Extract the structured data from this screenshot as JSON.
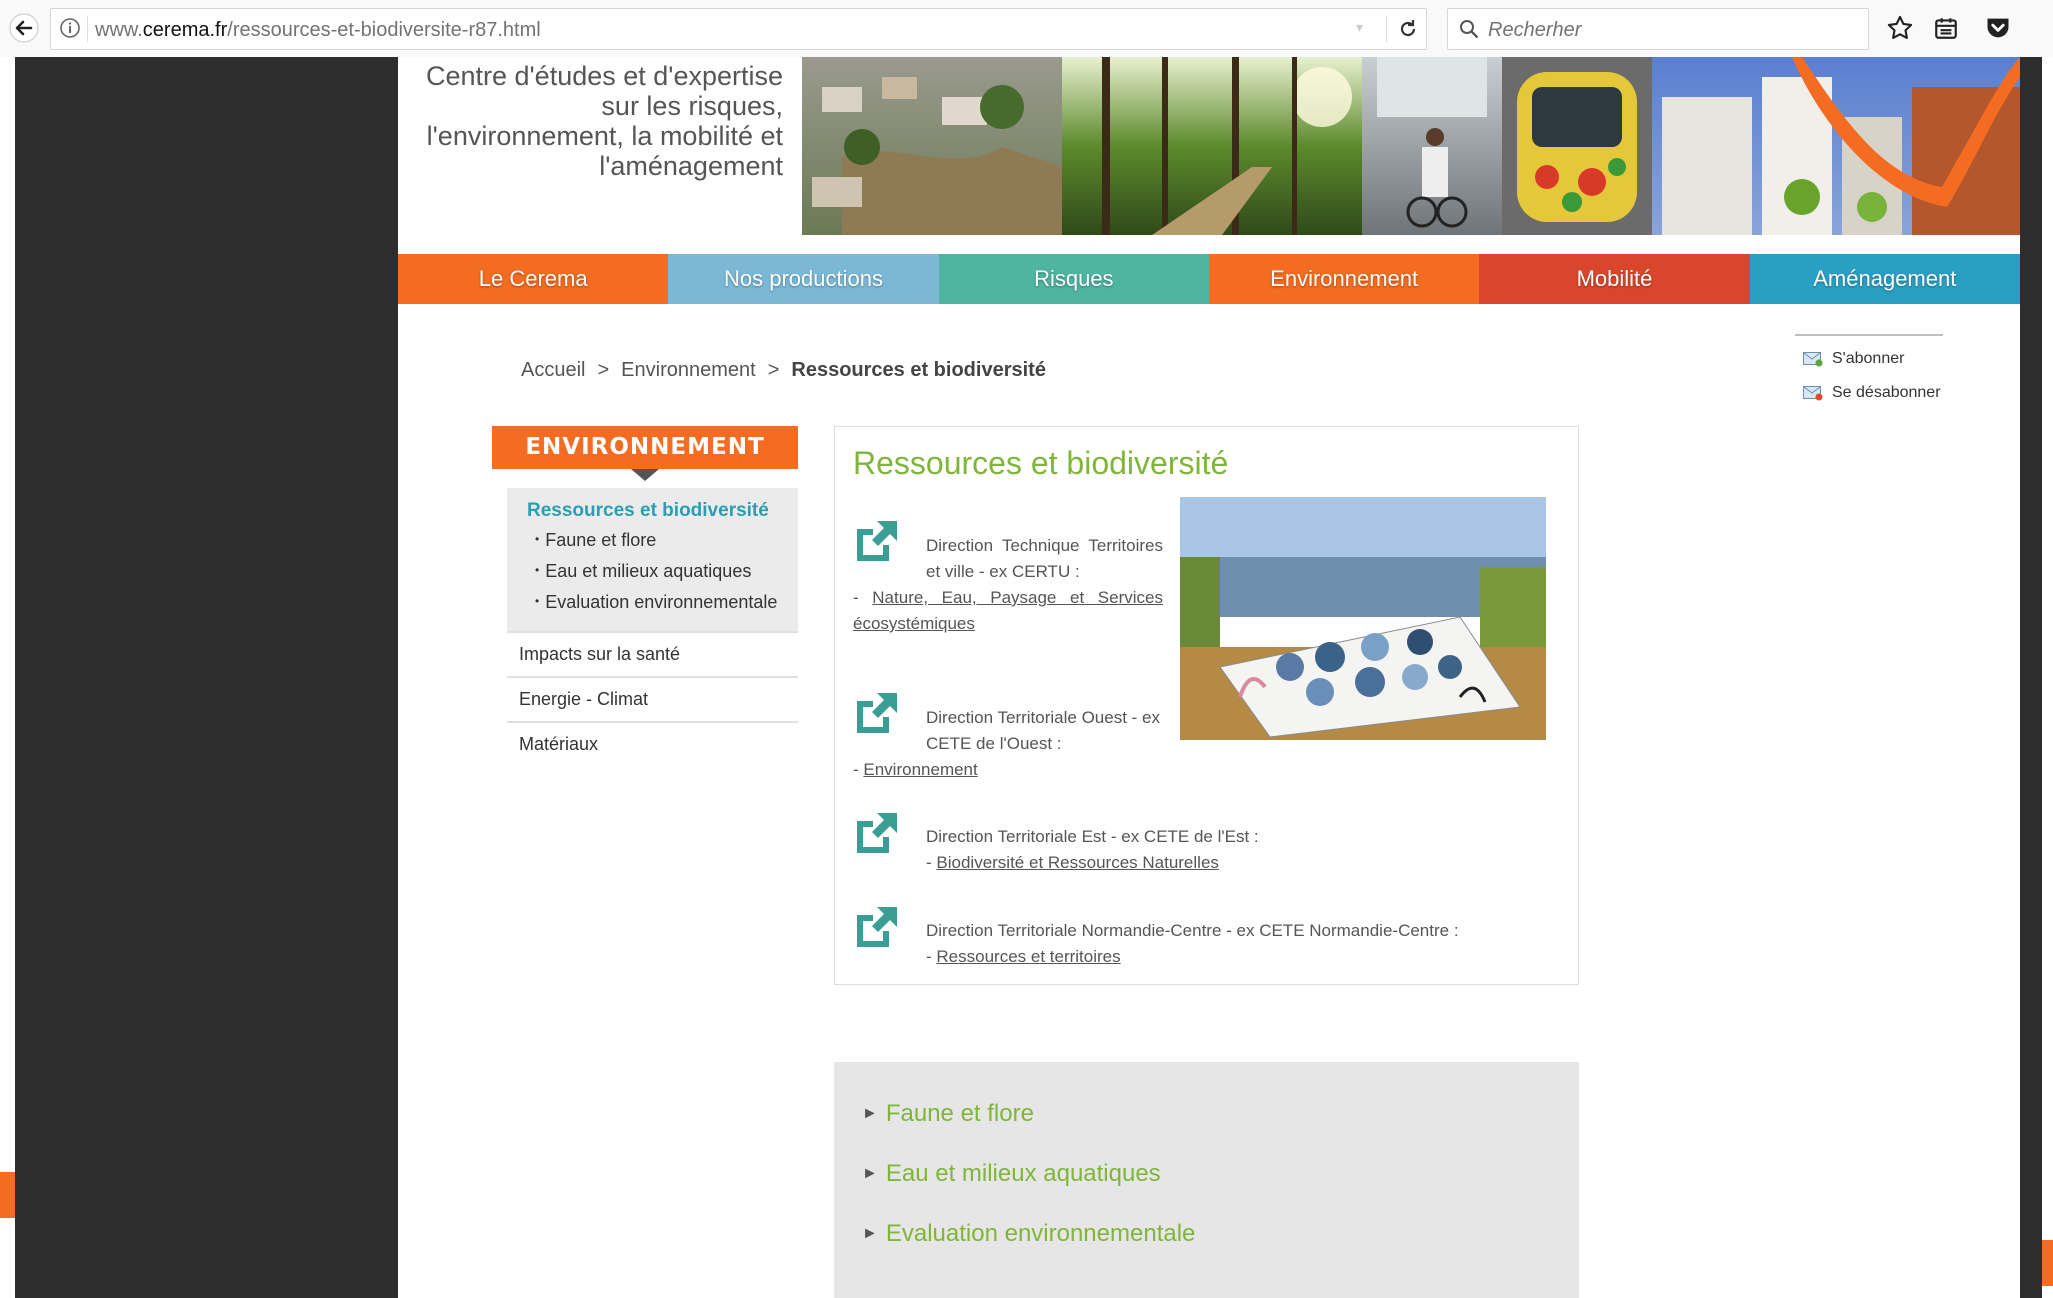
{
  "browser": {
    "url_prefix": "www.",
    "url_domain": "cerema.fr",
    "url_path": "/ressources-et-biodiversite-r87.html",
    "search_placeholder": "Recherher"
  },
  "header": {
    "tagline": "Centre d'études et d'expertise sur les risques, l'environnement, la mobilité et l'aménagement"
  },
  "nav": [
    {
      "label": "Le Cerema",
      "color": "#f36c21"
    },
    {
      "label": "Nos productions",
      "color": "#7ab8d6"
    },
    {
      "label": "Risques",
      "color": "#4fb4a0"
    },
    {
      "label": "Environnement",
      "color": "#f36c21"
    },
    {
      "label": "Mobilité",
      "color": "#d9462b"
    },
    {
      "label": "Aménagement",
      "color": "#2a9fc4"
    }
  ],
  "breadcrumb": {
    "home": "Accueil",
    "sep": ">",
    "section": "Environnement",
    "current": "Ressources et biodiversité"
  },
  "subscribe": {
    "subscribe_label": "S'abonner",
    "unsubscribe_label": "Se désabonner"
  },
  "sidebar": {
    "title": "ENVIRONNEMENT",
    "active": "Ressources et biodiversité",
    "subitems": [
      "Faune et flore",
      "Eau et milieux aquatiques",
      "Evaluation environnementale"
    ],
    "items": [
      "Impacts sur la santé",
      "Energie - Climat",
      "Matériaux"
    ]
  },
  "content": {
    "title": "Ressources et biodiversité",
    "blocks": [
      {
        "text": "Direction Technique Territoires et ville - ex CERTU :",
        "link": "Nature, Eau, Paysage et Services écosystémiques"
      },
      {
        "text": "Direction Territoriale Ouest - ex CETE de l'Ouest :",
        "link": "Environnement"
      },
      {
        "text": "Direction Territoriale Est - ex CETE de l'Est :",
        "link": "Biodiversité et Ressources Naturelles"
      },
      {
        "text": "Direction Territoriale Normandie-Centre - ex CETE Normandie-Centre :",
        "link": "Ressources et territoires"
      }
    ]
  },
  "accordion": [
    "Faune et flore",
    "Eau et milieux aquatiques",
    "Evaluation environnementale"
  ]
}
